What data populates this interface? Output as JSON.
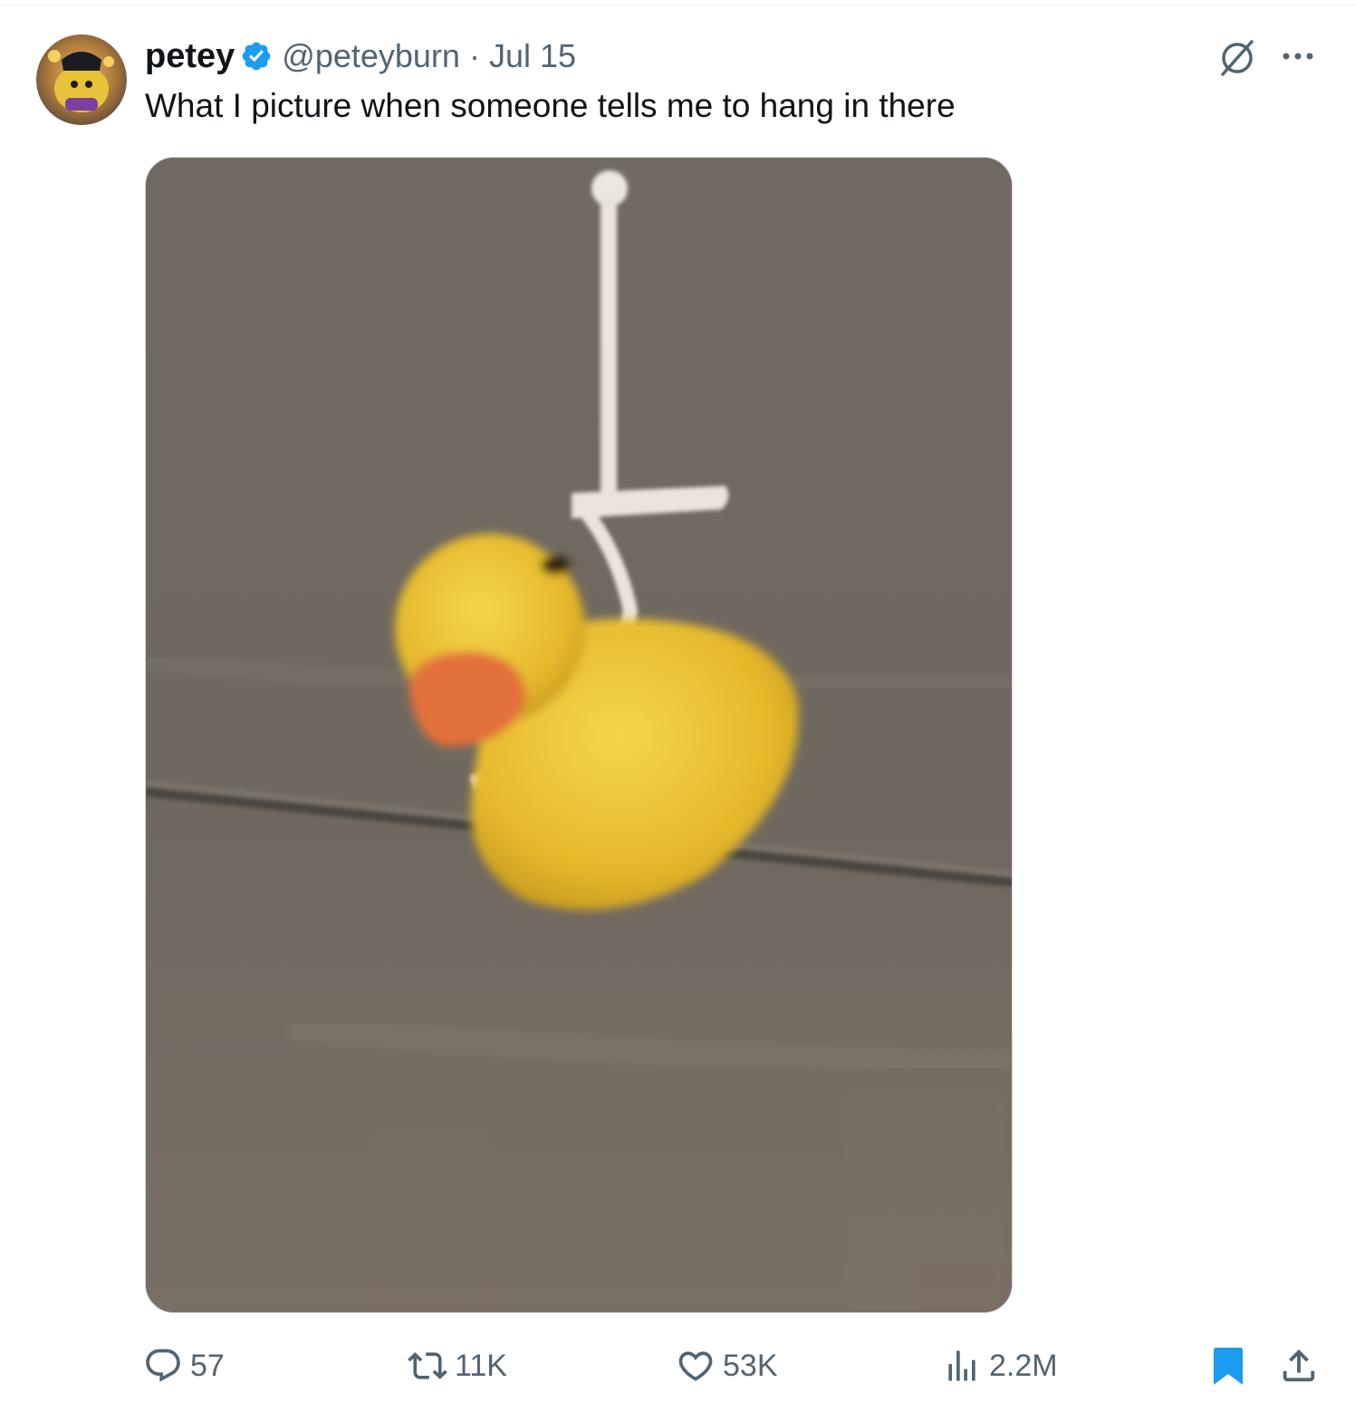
{
  "tweet": {
    "author": {
      "display_name": "petey",
      "handle": "@peteyburn",
      "verified": true
    },
    "separator": "·",
    "date": "Jul 15",
    "text": "What I picture when someone tells me to hang in there",
    "media": {
      "kind": "photo",
      "subject": "rubber-duck-hanging-from-string"
    },
    "actions": {
      "replies": "57",
      "retweets": "11K",
      "likes": "53K",
      "views": "2.2M",
      "bookmarked": true
    },
    "icons": {
      "reply": "speech-bubble-icon",
      "retweet": "retweet-arrows-icon",
      "like": "heart-icon",
      "views": "bar-chart-icon",
      "bookmark": "bookmark-icon",
      "share": "share-upload-icon",
      "grok": "grok-slash-circle-icon",
      "more": "ellipsis-icon",
      "verified": "verified-badge-icon"
    }
  },
  "colors": {
    "text_primary": "#0f1419",
    "text_secondary": "#536471",
    "accent_blue": "#1d9bf0",
    "bookmark_blue": "#1d9bf0",
    "border": "#cfd9de"
  }
}
